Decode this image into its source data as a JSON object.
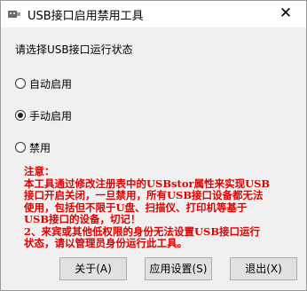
{
  "window": {
    "title": "USB接口启用禁用工具",
    "close_glyph": "✕"
  },
  "prompt": "请选择USB接口运行状态",
  "options": [
    {
      "label": "自动启用",
      "checked": false
    },
    {
      "label": "手动启用",
      "checked": true
    },
    {
      "label": "禁用",
      "checked": false
    }
  ],
  "notice": {
    "lines": [
      "注意：",
      "本工具通过修改注册表中的USBstor属性来实现USB",
      "接口开启关闭，一旦禁用，所有USB接口设备都无法",
      "使用，包括但不限于U盘、扫描仪、打印机等基于",
      "USB接口的设备，切记！",
      "2、来宾或其他低权限的身份无法设置USB接口运行",
      "状态，请以管理员身份运行此工具。"
    ],
    "color": "#e00000"
  },
  "buttons": {
    "about": "关于(A)",
    "apply": "应用设置(S)",
    "exit": "退出(X)"
  }
}
